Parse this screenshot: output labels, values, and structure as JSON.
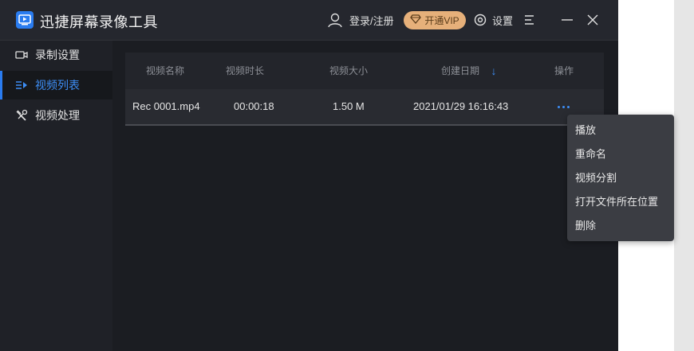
{
  "app": {
    "title": "迅捷屏幕录像工具"
  },
  "titlebar": {
    "login_label": "登录/注册",
    "vip_label": "开通VIP",
    "settings_label": "设置"
  },
  "sidebar": {
    "items": [
      {
        "label": "录制设置",
        "icon": "camera-icon"
      },
      {
        "label": "视频列表",
        "icon": "list-icon",
        "active": true
      },
      {
        "label": "视频处理",
        "icon": "tools-icon"
      }
    ]
  },
  "table": {
    "headers": [
      "视频名称",
      "视频时长",
      "视频大小",
      "创建日期",
      "操作"
    ],
    "sort_indicator": "↓",
    "rows": [
      {
        "name": "Rec 0001.mp4",
        "duration": "00:00:18",
        "size": "1.50 M",
        "date": "2021/01/29 16:16:43"
      }
    ]
  },
  "context_menu": {
    "items": [
      "播放",
      "重命名",
      "视频分割",
      "打开文件所在位置",
      "删除"
    ]
  },
  "colors": {
    "accent": "#2a7cf0",
    "vip": "#e6b07a",
    "background": "#1b1d22"
  }
}
